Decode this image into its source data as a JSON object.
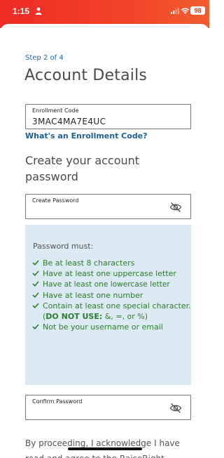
{
  "status_bar": {
    "time": "1:15",
    "battery": "98",
    "icons": [
      "person-icon",
      "signal-icon",
      "wifi-icon"
    ]
  },
  "colors": {
    "brand_red": "#ee2a24",
    "link_blue": "#1a5f96",
    "rule_green": "#2a7d2a",
    "rules_bg": "#dcebf3"
  },
  "page": {
    "step": "Step 2 of 4",
    "title": "Account Details"
  },
  "enrollment": {
    "label": "Enrollment Code",
    "value": "3MAC4MA7E4UC",
    "help_link": "What's an Enrollment Code?"
  },
  "password_section": {
    "title": "Create your account password",
    "create_label": "Create Password",
    "create_value": "",
    "confirm_label": "Confirm Password",
    "confirm_value": "",
    "toggle_icon": "eye-slash-icon"
  },
  "rules": {
    "heading": "Password must:",
    "items": [
      "Be at least 8 characters",
      "Have at least one uppercase letter",
      "Have at least one lowercase letter",
      "Have at least one number",
      "Contain at least one special character.",
      "Not be your username or email"
    ],
    "special_note_bold": "DO NOT USE:",
    "special_note_rest": " &, =, or %)",
    "special_note_open": "("
  },
  "footer": {
    "ack_text": "By proceeding, I acknowledge I have read and agree to the RaiseRight"
  }
}
